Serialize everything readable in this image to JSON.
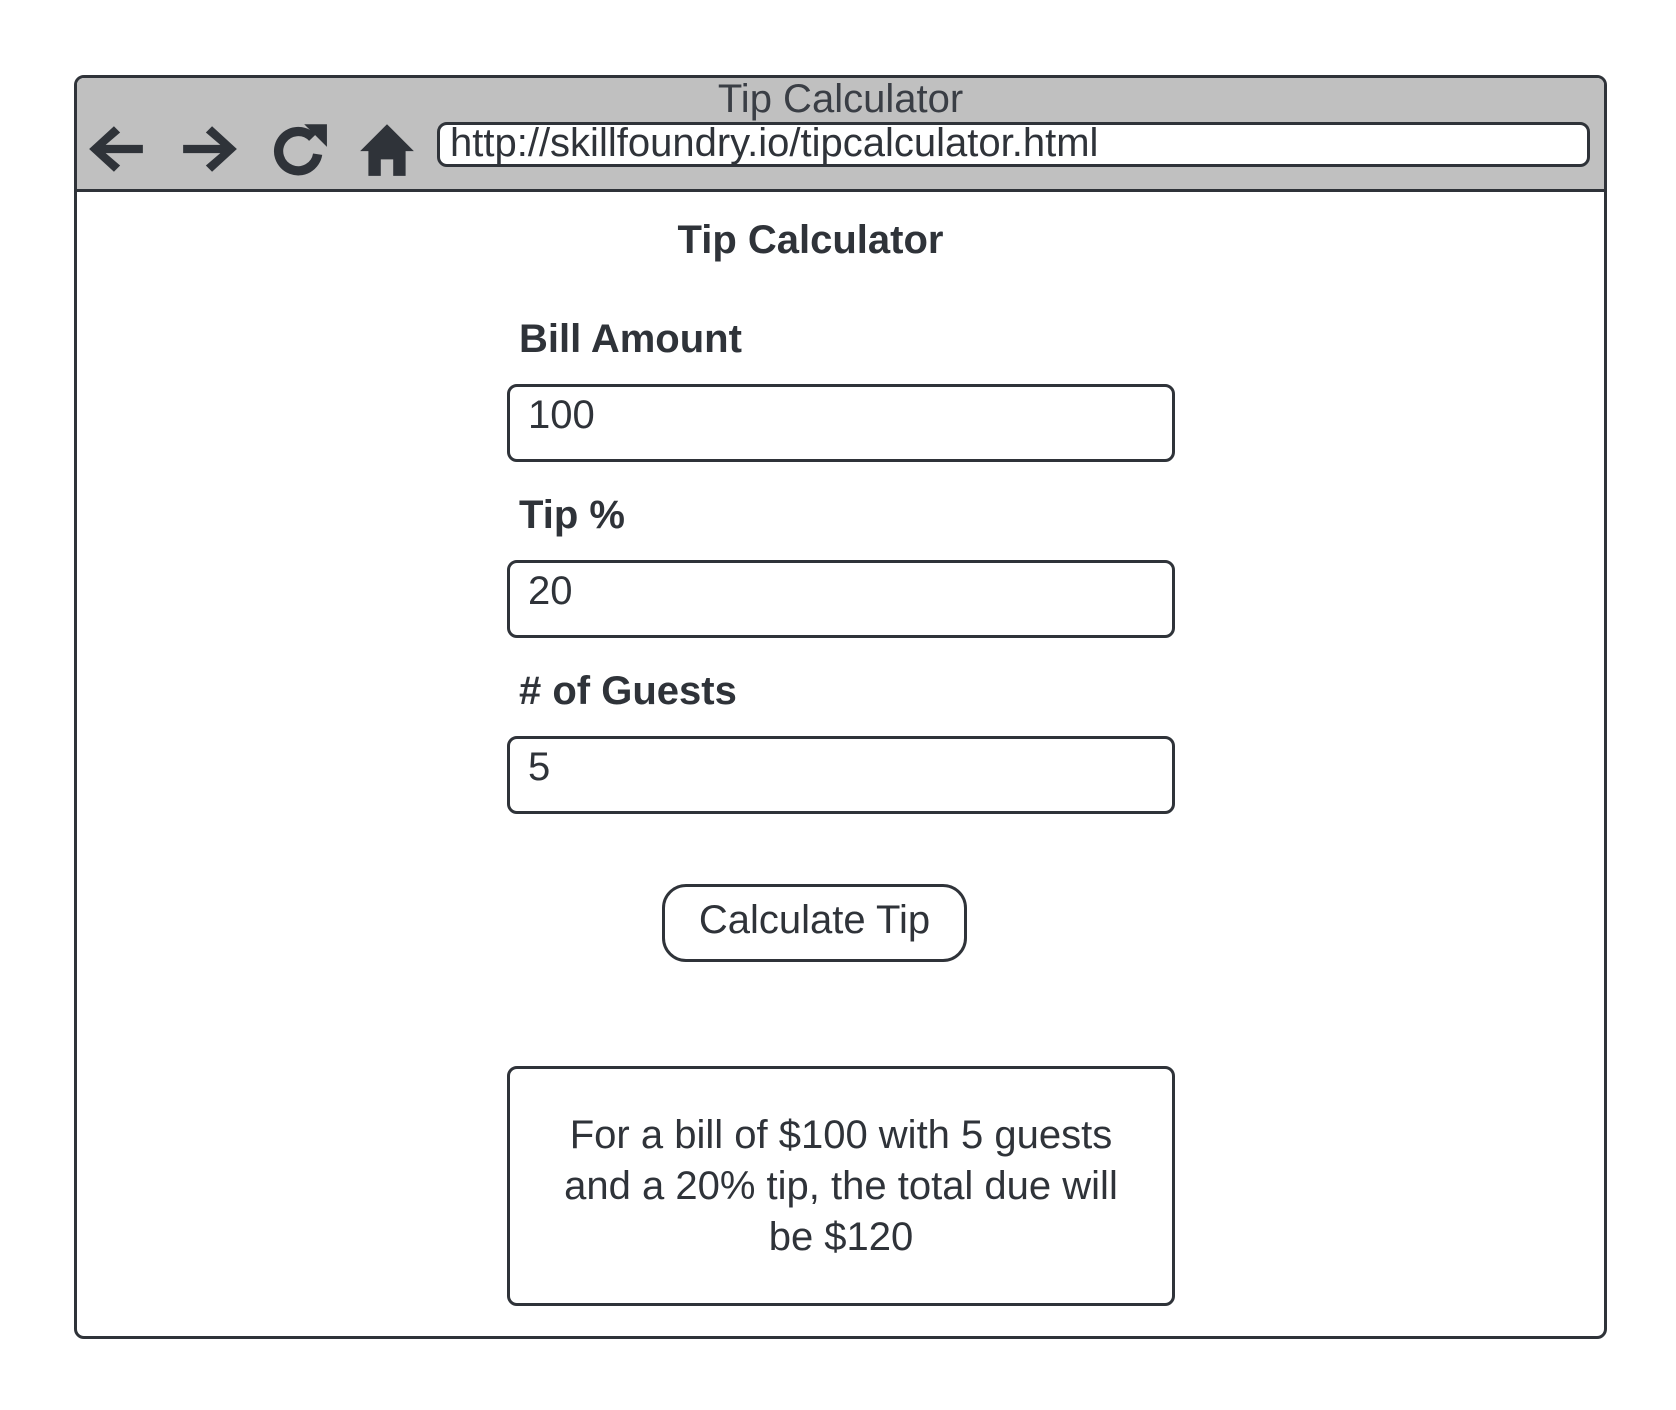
{
  "window": {
    "title": "Tip Calculator",
    "url": "http://skillfoundry.io/tipcalculator.html"
  },
  "toolbar": {
    "back_icon": "arrow-left-icon",
    "forward_icon": "arrow-right-icon",
    "reload_icon": "reload-icon",
    "home_icon": "home-icon"
  },
  "page": {
    "heading": "Tip Calculator"
  },
  "form": {
    "bill_label": "Bill Amount",
    "bill_value": "100",
    "tip_label": "Tip %",
    "tip_value": "20",
    "guests_label": "# of Guests",
    "guests_value": "5",
    "calculate_label": "Calculate Tip"
  },
  "result": {
    "text": "For a bill of $100 with 5 guests and a 20% tip, the total due will be $120"
  },
  "colors": {
    "chrome": "#c0c0c0",
    "ink": "#2f3339",
    "background": "#ffffff"
  }
}
